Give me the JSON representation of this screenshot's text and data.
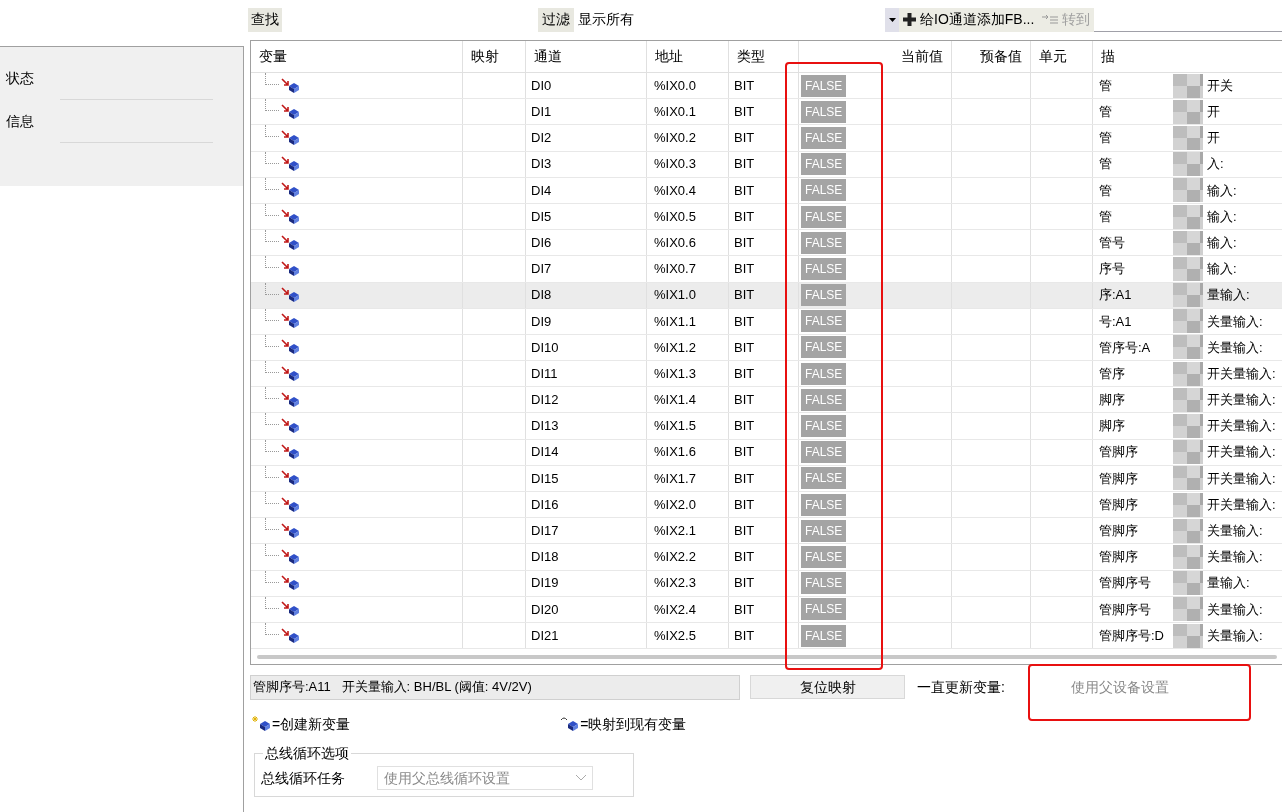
{
  "sidebar": {
    "items": [
      {
        "label": "状态",
        "selected": false
      },
      {
        "label": "信息",
        "selected": false
      }
    ]
  },
  "toolbar": {
    "find_label": "查找",
    "filter_label": "过滤",
    "filter_value": "显示所有",
    "add_fb_button": "给IO通道添加FB...",
    "goto_button": {
      "label": "转到",
      "disabled": true
    }
  },
  "table": {
    "columns": [
      "变量",
      "映射",
      "通道",
      "地址",
      "类型",
      "当前值",
      "预备值",
      "单元",
      "描"
    ],
    "rows": [
      {
        "channel": "DI0",
        "address": "%IX0.0",
        "type": "BIT",
        "current_value": "FALSE",
        "description_1": "管",
        "description_2": "开关",
        "selected": false
      },
      {
        "channel": "DI1",
        "address": "%IX0.1",
        "type": "BIT",
        "current_value": "FALSE",
        "description_1": "管",
        "description_2": "开",
        "selected": false
      },
      {
        "channel": "DI2",
        "address": "%IX0.2",
        "type": "BIT",
        "current_value": "FALSE",
        "description_1": "管",
        "description_2": "开",
        "selected": false
      },
      {
        "channel": "DI3",
        "address": "%IX0.3",
        "type": "BIT",
        "current_value": "FALSE",
        "description_1": "管",
        "description_2": "入:",
        "selected": false
      },
      {
        "channel": "DI4",
        "address": "%IX0.4",
        "type": "BIT",
        "current_value": "FALSE",
        "description_1": "管",
        "description_2": "输入:",
        "selected": false
      },
      {
        "channel": "DI5",
        "address": "%IX0.5",
        "type": "BIT",
        "current_value": "FALSE",
        "description_1": "管",
        "description_2": "输入:",
        "selected": false
      },
      {
        "channel": "DI6",
        "address": "%IX0.6",
        "type": "BIT",
        "current_value": "FALSE",
        "description_1": "管号",
        "description_2": "输入:",
        "selected": false
      },
      {
        "channel": "DI7",
        "address": "%IX0.7",
        "type": "BIT",
        "current_value": "FALSE",
        "description_1": "序号",
        "description_2": "输入:",
        "selected": false
      },
      {
        "channel": "DI8",
        "address": "%IX1.0",
        "type": "BIT",
        "current_value": "FALSE",
        "description_1": "序:A1",
        "description_2": "量输入:",
        "selected": true
      },
      {
        "channel": "DI9",
        "address": "%IX1.1",
        "type": "BIT",
        "current_value": "FALSE",
        "description_1": "号:A1",
        "description_2": "关量输入:",
        "selected": false
      },
      {
        "channel": "DI10",
        "address": "%IX1.2",
        "type": "BIT",
        "current_value": "FALSE",
        "description_1": "管序号:A",
        "description_2": "关量输入:",
        "selected": false
      },
      {
        "channel": "DI11",
        "address": "%IX1.3",
        "type": "BIT",
        "current_value": "FALSE",
        "description_1": "管序",
        "description_2": "开关量输入:",
        "selected": false
      },
      {
        "channel": "DI12",
        "address": "%IX1.4",
        "type": "BIT",
        "current_value": "FALSE",
        "description_1": "脚序",
        "description_2": "开关量输入:",
        "selected": false
      },
      {
        "channel": "DI13",
        "address": "%IX1.5",
        "type": "BIT",
        "current_value": "FALSE",
        "description_1": "脚序",
        "description_2": "开关量输入:",
        "selected": false
      },
      {
        "channel": "DI14",
        "address": "%IX1.6",
        "type": "BIT",
        "current_value": "FALSE",
        "description_1": "管脚序",
        "description_2": "开关量输入:",
        "selected": false
      },
      {
        "channel": "DI15",
        "address": "%IX1.7",
        "type": "BIT",
        "current_value": "FALSE",
        "description_1": "管脚序",
        "description_2": "开关量输入:",
        "selected": false
      },
      {
        "channel": "DI16",
        "address": "%IX2.0",
        "type": "BIT",
        "current_value": "FALSE",
        "description_1": "管脚序",
        "description_2": "开关量输入:",
        "selected": false
      },
      {
        "channel": "DI17",
        "address": "%IX2.1",
        "type": "BIT",
        "current_value": "FALSE",
        "description_1": "管脚序",
        "description_2": "关量输入:",
        "selected": false
      },
      {
        "channel": "DI18",
        "address": "%IX2.2",
        "type": "BIT",
        "current_value": "FALSE",
        "description_1": "管脚序",
        "description_2": "关量输入:",
        "selected": false
      },
      {
        "channel": "DI19",
        "address": "%IX2.3",
        "type": "BIT",
        "current_value": "FALSE",
        "description_1": "管脚序号",
        "description_2": "量输入:",
        "selected": false
      },
      {
        "channel": "DI20",
        "address": "%IX2.4",
        "type": "BIT",
        "current_value": "FALSE",
        "description_1": "管脚序号",
        "description_2": "关量输入:",
        "selected": false
      },
      {
        "channel": "DI21",
        "address": "%IX2.5",
        "type": "BIT",
        "current_value": "FALSE",
        "description_1": "管脚序号:D",
        "description_2": "关量输入:",
        "selected": false
      }
    ]
  },
  "footer": {
    "description": "管脚序号:A11   开关量输入: BH/BL (阈值: 4V/2V)",
    "reset_button": "复位映射",
    "update_label": "一直更新变量:",
    "update_value": "使用父设备设置",
    "legend": [
      "=创建新变量",
      "=映射到现有变量"
    ],
    "bus_group": {
      "title": "总线循环选项",
      "task_label": "总线循环任务",
      "task_value": "使用父总线循环设置"
    }
  }
}
